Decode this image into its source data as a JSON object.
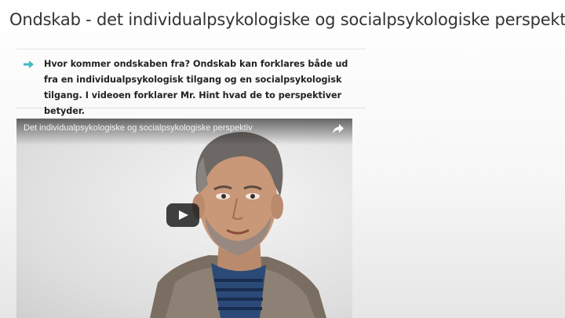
{
  "page": {
    "title": "Ondskab - det individualpsykologiske og socialpsykologiske perspektiv"
  },
  "intro": {
    "text": "Hvor kommer ondskaben fra? Ondskab kan forklares både ud fra en individualpsykologisk tilgang og en socialpsykologisk tilgang. I videoen forklarer Mr. Hint hvad de to perspektiver betyder.",
    "arrow_icon": "arrow-right-icon",
    "accent_color": "#3fbcc7"
  },
  "video": {
    "title": "Det individualpsykologiske og socialpsykologiske perspektiv",
    "share_icon": "share-icon",
    "play_icon": "play-icon",
    "play_button_color": "#212121"
  }
}
